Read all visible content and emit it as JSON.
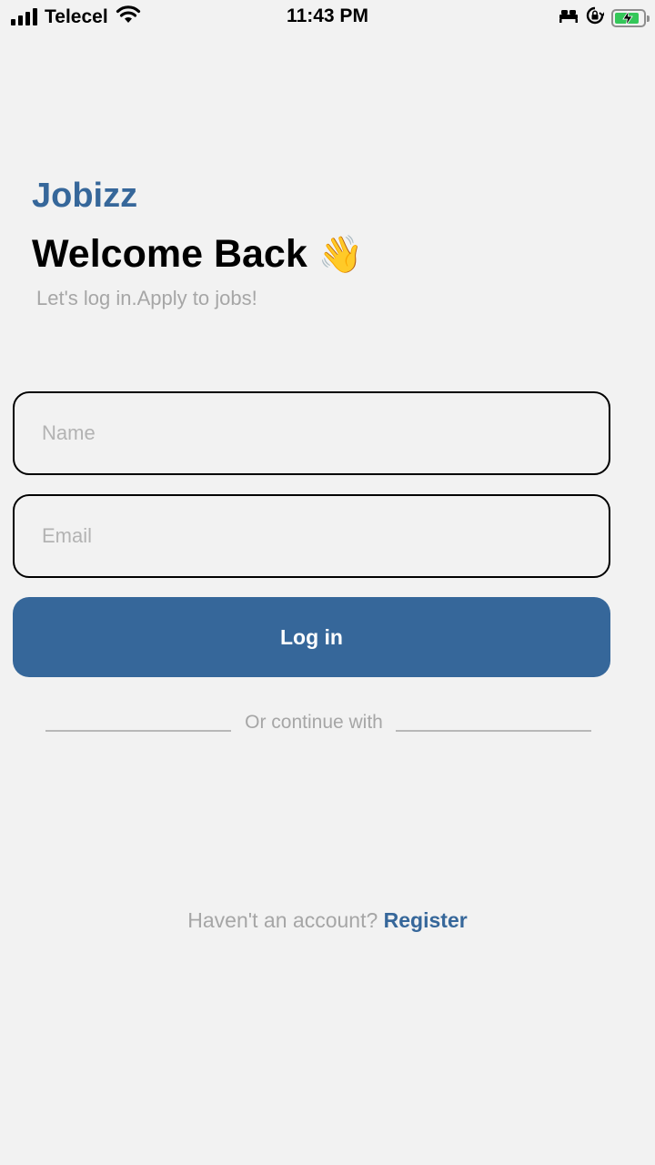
{
  "status_bar": {
    "carrier": "Telecel",
    "time": "11:43 PM",
    "icons": [
      "signal-icon",
      "wifi-icon",
      "bed-icon",
      "rotation-lock-icon",
      "battery-icon"
    ],
    "battery_color": "#34c759"
  },
  "header": {
    "brand": "Jobizz",
    "title": "Welcome Back",
    "title_emoji": "👋",
    "subtitle": "Let's log in.Apply to jobs!"
  },
  "form": {
    "name_placeholder": "Name",
    "name_value": "",
    "email_placeholder": "Email",
    "email_value": "",
    "login_label": "Log in",
    "divider_text": "Or continue with"
  },
  "footer": {
    "question": "Haven't an account?",
    "register_label": "Register"
  },
  "colors": {
    "accent": "#36679a",
    "background": "#f2f2f2",
    "muted_text": "#a6a6a6"
  }
}
